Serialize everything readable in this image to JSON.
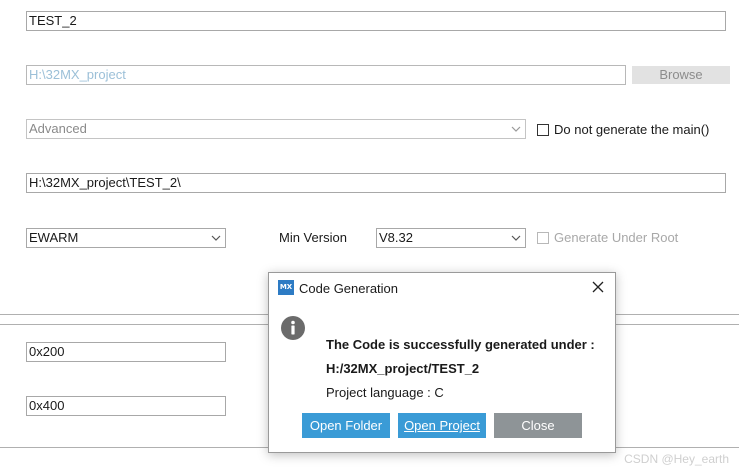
{
  "project": {
    "name_value": "TEST_2",
    "location_value": "H:\\32MX_project",
    "browse_label": "Browse",
    "app_structure_value": "Advanced",
    "no_main_label": "Do not generate the main()",
    "toolchain_folder_value": "H:\\32MX_project\\TEST_2\\",
    "toolchain_value": "EWARM",
    "min_version_label": "Min Version",
    "min_version_value": "V8.32",
    "generate_under_root_label": "Generate Under Root"
  },
  "linker": {
    "heap_value": "0x200",
    "stack_value": "0x400"
  },
  "dialog": {
    "title": "Code Generation",
    "logo_text": "MX",
    "message_line1": "The Code is successfully generated under :",
    "message_line2": "H:/32MX_project/TEST_2",
    "message_line3": "Project language : C",
    "open_folder_label": "Open Folder",
    "open_project_label": "Open Project",
    "close_label": "Close"
  },
  "watermark": "CSDN @Hey_earth",
  "colors": {
    "accent_blue": "#3a9bd6",
    "close_grey": "#8e9497",
    "logo_blue": "#2d7bc4"
  }
}
